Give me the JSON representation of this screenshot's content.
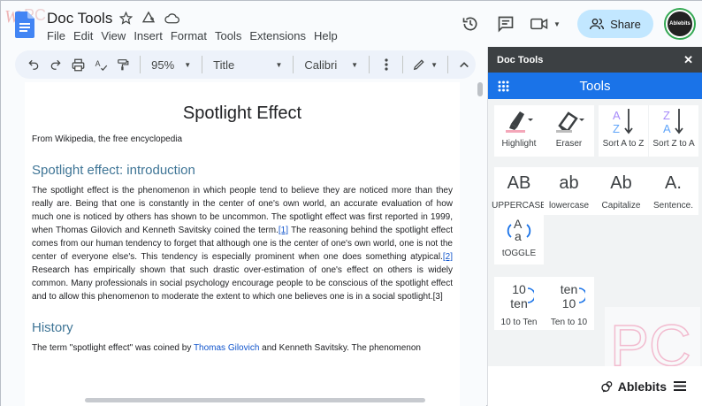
{
  "app": {
    "doc_title": "Doc Tools",
    "menu": [
      "File",
      "Edit",
      "View",
      "Insert",
      "Format",
      "Tools",
      "Extensions",
      "Help"
    ],
    "share_label": "Share",
    "avatar_text": "Ablebits"
  },
  "toolbar": {
    "zoom": "95%",
    "style": "Title",
    "font": "Calibri"
  },
  "document": {
    "title": "Spotlight Effect",
    "source": "From Wikipedia, the free encyclopedia",
    "heading1": "Spotlight effect: introduction",
    "para1_a": "The spotlight effect is the phenomenon in which people tend to believe they are noticed more than they really are. Being that one is constantly in the center of one's own world, an accurate evaluation of how much one is noticed by others has shown to be uncommon. The spotlight effect was first reported in 1999, when Thomas Gilovich and Kenneth Savitsky coined the term.",
    "ref1": "[1]",
    "para1_b": " The reasoning behind the spotlight effect comes from our human tendency to forget that although one is the center of one's own world, one is not the center of everyone else's. This tendency is especially prominent when one does something atypical.",
    "ref2": "[2]",
    "para1_c": " Research has empirically shown that such drastic over-estimation of one's effect on others is widely common. Many professionals in social psychology encourage people to be conscious of the spotlight effect and to allow this phenomenon to moderate the extent to which one believes one is in a social spotlight.[3]",
    "heading2": "History",
    "para2_a": "The term \"spotlight effect\" was coined by ",
    "para2_link": "Thomas Gilovich",
    "para2_b": " and Kenneth Savitsky. The phenomenon"
  },
  "panel": {
    "header": "Doc Tools",
    "close": "✕",
    "title": "Tools",
    "tools": [
      {
        "label": "Highlight"
      },
      {
        "label": "Eraser"
      },
      {
        "label": "Sort A to Z"
      },
      {
        "label": "Sort Z to A"
      },
      {
        "label": "UPPERCASE",
        "glyph": "AB"
      },
      {
        "label": "lowercase",
        "glyph": "ab"
      },
      {
        "label": "Capitalize",
        "glyph": "Ab"
      },
      {
        "label": "Sentence.",
        "glyph": "A."
      },
      {
        "label": "tOGGLE"
      },
      {
        "label": "10 to Ten",
        "glyph_top": "10",
        "glyph_bottom": "ten"
      },
      {
        "label": "Ten to 10",
        "glyph_top": "ten",
        "glyph_bottom": "10"
      }
    ],
    "footer_brand": "Ablebits"
  },
  "colors": {
    "accent": "#1a73e8",
    "share_bg": "#c2e7ff",
    "heading": "#3f7596",
    "panel_header": "#3c4043"
  }
}
